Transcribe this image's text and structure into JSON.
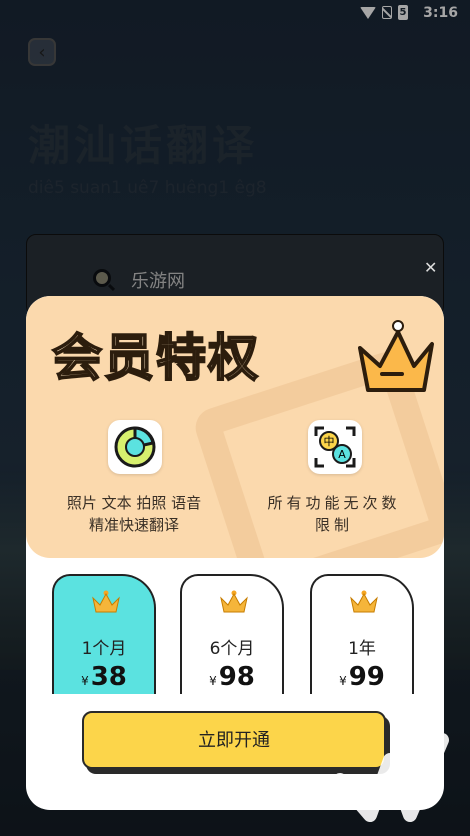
{
  "status_bar": {
    "time": "3:16",
    "battery": "5"
  },
  "header": {
    "title": "潮汕话翻译",
    "pinyin": "diê5 suan1 uê7 huêng1 êg8"
  },
  "search": {
    "value": "乐游网"
  },
  "modal": {
    "title": "会员特权",
    "perks": [
      {
        "icon": "pie-chart-icon",
        "text_line1": "照片 文本 拍照 语音",
        "text_line2": "精准快速翻译"
      },
      {
        "icon": "translate-icon",
        "text_line1": "所有功能无次数",
        "text_line2": "限制",
        "icon_labels": [
          "中",
          "A"
        ]
      }
    ],
    "plans": [
      {
        "name": "1个月",
        "currency": "¥",
        "price": "38",
        "selected": true
      },
      {
        "name": "6个月",
        "currency": "¥",
        "price": "98",
        "selected": false
      },
      {
        "name": "1年",
        "currency": "¥",
        "price": "99",
        "selected": false
      }
    ],
    "cta_label": "立即开通"
  },
  "colors": {
    "accent_yellow": "#fcd54a",
    "selected_plan": "#5be2e0",
    "perk_panel": "#fbd9ad"
  }
}
